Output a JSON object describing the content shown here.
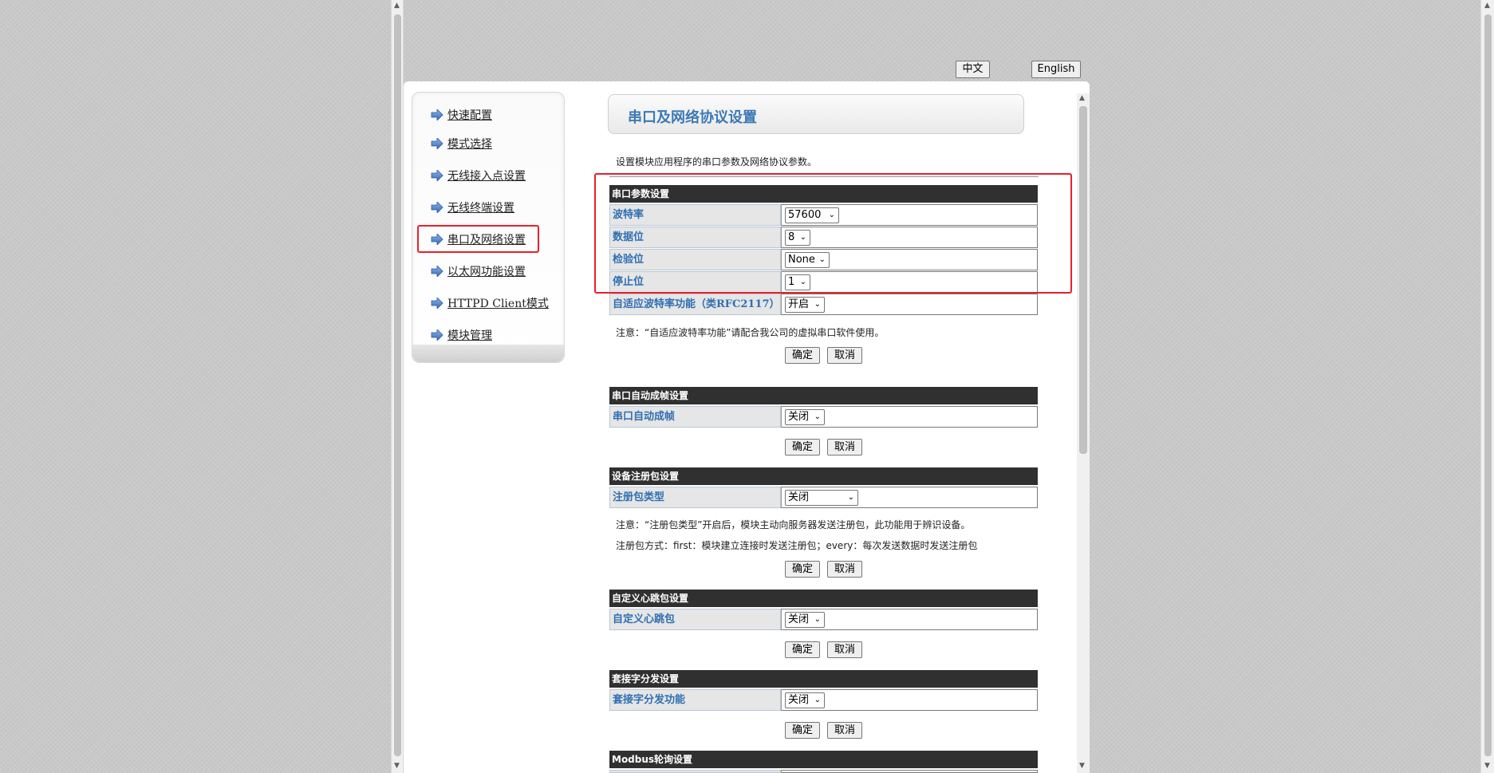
{
  "lang": {
    "zh": "中文",
    "en": "English"
  },
  "sidebar": {
    "items": [
      {
        "label": "快速配置"
      },
      {
        "label": "模式选择"
      },
      {
        "label": "无线接入点设置"
      },
      {
        "label": "无线终端设置"
      },
      {
        "label": "串口及网络设置"
      },
      {
        "label": "以太网功能设置"
      },
      {
        "label": "HTTPD Client模式"
      },
      {
        "label": "模块管理"
      }
    ],
    "active_index": 4
  },
  "page": {
    "title": "串口及网络协议设置",
    "description": "设置模块应用程序的串口参数及网络协议参数。"
  },
  "serial": {
    "header": "串口参数设置",
    "baud_label": "波特率",
    "baud_value": "57600",
    "data_label": "数据位",
    "data_value": "8",
    "parity_label": "检验位",
    "parity_value": "None",
    "stop_label": "停止位",
    "stop_value": "1",
    "adaptive_label": "自适应波特率功能（类RFC2117）",
    "adaptive_value": "开启",
    "note": "注意：“自适应波特率功能”请配合我公司的虚拟串口软件使用。"
  },
  "framing": {
    "header": "串口自动成帧设置",
    "label": "串口自动成帧",
    "value": "关闭"
  },
  "register": {
    "header": "设备注册包设置",
    "label": "注册包类型",
    "value": "关闭",
    "note1": "注意：“注册包类型”开启后，模块主动向服务器发送注册包，此功能用于辨识设备。",
    "note2": "注册包方式：first：模块建立连接时发送注册包；every：每次发送数据时发送注册包"
  },
  "heartbeat": {
    "header": "自定义心跳包设置",
    "label": "自定义心跳包",
    "value": "关闭"
  },
  "socket": {
    "header": "套接字分发设置",
    "label": "套接字分发功能",
    "value": "关闭"
  },
  "modbus": {
    "header": "Modbus轮询设置"
  },
  "buttons": {
    "ok": "确定",
    "cancel": "取消"
  },
  "colors": {
    "highlight": "#e8202a",
    "label_blue": "#2f6fb2",
    "title_blue": "#3c79b6",
    "section_header": "#303030"
  }
}
